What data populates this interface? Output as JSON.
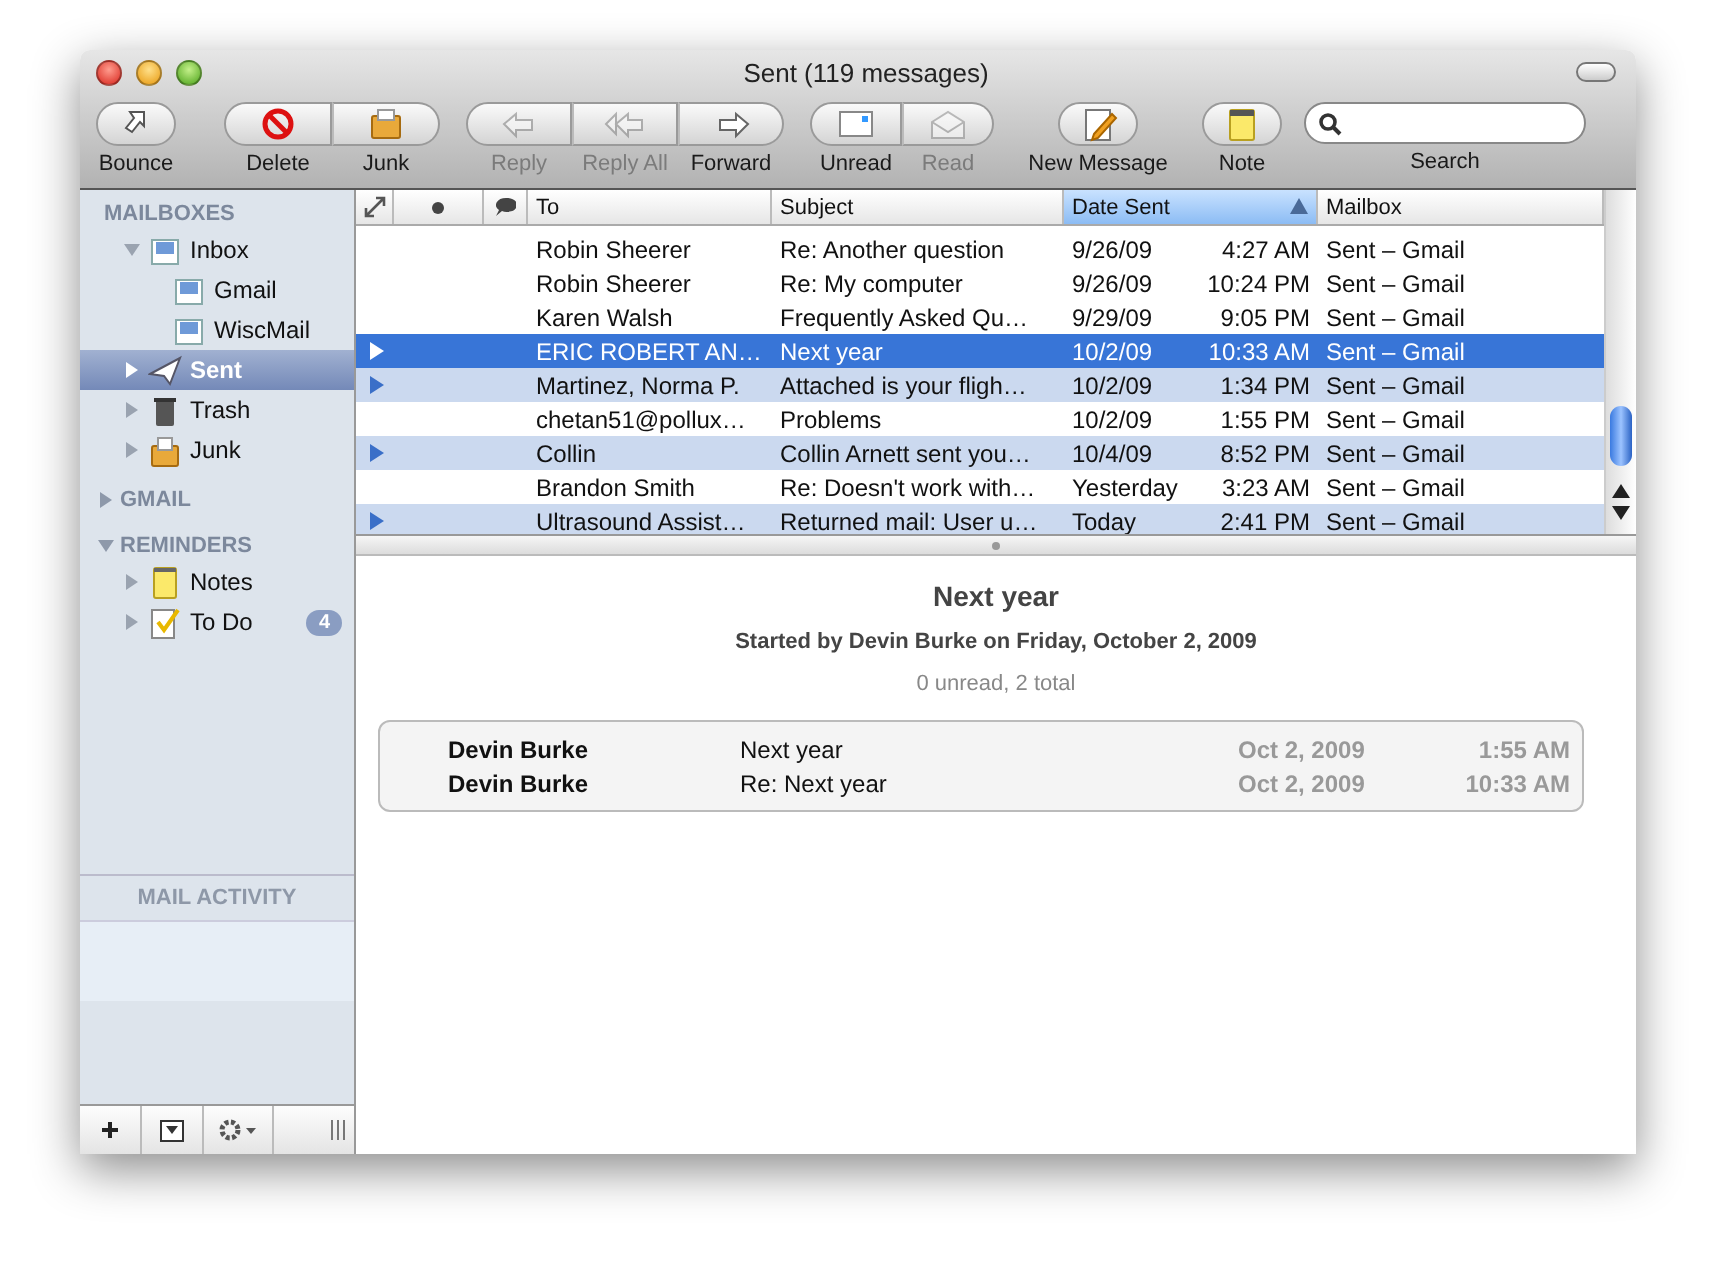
{
  "window": {
    "title": "Sent (119 messages)"
  },
  "toolbar": {
    "groups": [
      {
        "buttons": [
          {
            "label": "Bounce",
            "kind": "bounce",
            "disabled": false
          }
        ]
      },
      {
        "buttons": [
          {
            "label": "Delete",
            "kind": "delete",
            "disabled": false
          },
          {
            "label": "Junk",
            "kind": "junk",
            "disabled": false
          }
        ]
      },
      {
        "buttons": [
          {
            "label": "Reply",
            "kind": "reply",
            "disabled": true
          },
          {
            "label": "Reply All",
            "kind": "replyall",
            "disabled": true
          },
          {
            "label": "Forward",
            "kind": "forward",
            "disabled": false
          }
        ]
      },
      {
        "buttons": [
          {
            "label": "Unread",
            "kind": "unread",
            "disabled": false
          },
          {
            "label": "Read",
            "kind": "read",
            "disabled": true
          }
        ]
      },
      {
        "buttons": [
          {
            "label": "New Message",
            "kind": "compose",
            "disabled": false
          }
        ]
      },
      {
        "buttons": [
          {
            "label": "Note",
            "kind": "note",
            "disabled": false
          }
        ]
      }
    ],
    "search": {
      "label": "Search"
    }
  },
  "sidebar": {
    "sections": [
      {
        "title": "MAILBOXES",
        "items": [
          {
            "label": "Inbox",
            "kind": "inbox",
            "expanded": true,
            "selected": false,
            "children": [
              {
                "label": "Gmail",
                "kind": "inbox",
                "selected": false
              },
              {
                "label": "WiscMail",
                "kind": "inbox",
                "selected": false
              }
            ]
          },
          {
            "label": "Sent",
            "kind": "sent",
            "expanded": false,
            "selected": true
          },
          {
            "label": "Trash",
            "kind": "trash",
            "expanded": false,
            "selected": false
          },
          {
            "label": "Junk",
            "kind": "junk",
            "expanded": false,
            "selected": false
          }
        ]
      },
      {
        "title": "GMAIL",
        "expanded": false
      },
      {
        "title": "REMINDERS",
        "expanded": true,
        "items": [
          {
            "label": "Notes",
            "kind": "notes",
            "expanded": false,
            "selected": false
          },
          {
            "label": "To Do",
            "kind": "todo",
            "expanded": false,
            "selected": false,
            "badge": "4"
          }
        ]
      }
    ],
    "activity": {
      "title": "MAIL ACTIVITY"
    }
  },
  "table": {
    "columns": [
      {
        "kind": "threads",
        "selected": false
      },
      {
        "kind": "unread",
        "selected": false
      },
      {
        "kind": "replied",
        "selected": false
      },
      {
        "kind": "text",
        "label": "To",
        "selected": false
      },
      {
        "kind": "text",
        "label": "Subject",
        "selected": false
      },
      {
        "kind": "text",
        "label": "Date Sent",
        "selected": true
      },
      {
        "kind": "text",
        "label": "Mailbox",
        "selected": false
      }
    ],
    "rows": [
      {
        "to": "Robin Sheerer",
        "subject": "Re: Another question",
        "date": "9/26/09",
        "time": "4:27 AM",
        "mailbox": "Sent – Gmail",
        "thread": false,
        "selected": false
      },
      {
        "to": "Robin Sheerer",
        "subject": "Re: My computer",
        "date": "9/26/09",
        "time": "10:24 PM",
        "mailbox": "Sent – Gmail",
        "thread": false,
        "selected": false
      },
      {
        "to": "Karen Walsh",
        "subject": "Frequently Asked Qu…",
        "date": "9/29/09",
        "time": "9:05 PM",
        "mailbox": "Sent – Gmail",
        "thread": false,
        "selected": false
      },
      {
        "to": "ERIC ROBERT AN…",
        "subject": "Next year",
        "date": "10/2/09",
        "time": "10:33 AM",
        "mailbox": "Sent – Gmail",
        "thread": true,
        "selected": true
      },
      {
        "to": "Martinez, Norma P.",
        "subject": "Attached is your fligh…",
        "date": "10/2/09",
        "time": "1:34 PM",
        "mailbox": "Sent – Gmail",
        "thread": true,
        "selected": false
      },
      {
        "to": "chetan51@pollux…",
        "subject": "Problems",
        "date": "10/2/09",
        "time": "1:55 PM",
        "mailbox": "Sent – Gmail",
        "thread": false,
        "selected": false
      },
      {
        "to": "Collin",
        "subject": "Collin Arnett sent you…",
        "date": "10/4/09",
        "time": "8:52 PM",
        "mailbox": "Sent – Gmail",
        "thread": true,
        "selected": false
      },
      {
        "to": "Brandon Smith",
        "subject": "Re: Doesn't work with…",
        "date": "Yesterday",
        "time": "3:23 AM",
        "mailbox": "Sent – Gmail",
        "thread": false,
        "selected": false
      },
      {
        "to": "Ultrasound Assist…",
        "subject": "Returned mail: User u…",
        "date": "Today",
        "time": "2:41 PM",
        "mailbox": "Sent – Gmail",
        "thread": true,
        "selected": false
      }
    ]
  },
  "preview": {
    "title": "Next year",
    "subtitle": "Started by Devin Burke on Friday, October 2, 2009",
    "count": "0 unread, 2 total",
    "messages": [
      {
        "from": "Devin Burke",
        "subject": "Next year",
        "date": "Oct 2, 2009",
        "time": "1:55 AM"
      },
      {
        "from": "Devin Burke",
        "subject": "Re: Next year",
        "date": "Oct 2, 2009",
        "time": "10:33 AM"
      }
    ]
  }
}
